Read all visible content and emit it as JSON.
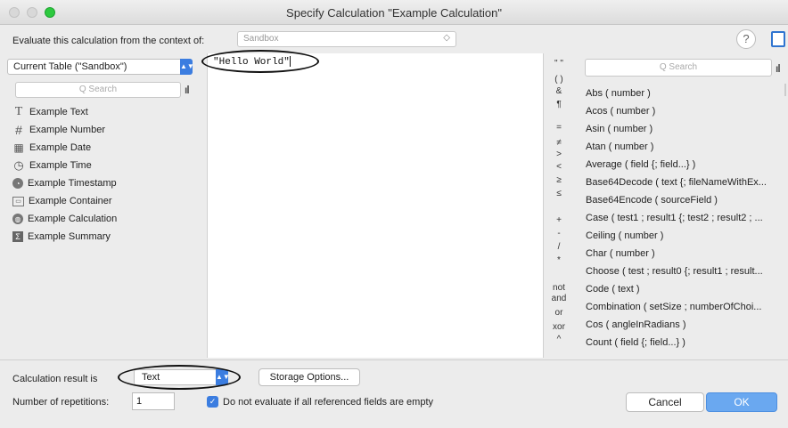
{
  "window": {
    "title": "Specify Calculation \"Example Calculation\""
  },
  "context": {
    "label": "Evaluate this calculation from the context of:",
    "value": "Sandbox",
    "arrows": "◇"
  },
  "help_glyph": "?",
  "left_pane": {
    "table_select": "Current Table (\"Sandbox\")",
    "search_placeholder": "Q Search",
    "fields": [
      {
        "label": "Example Text",
        "icon": "text-icon",
        "glyph": "T"
      },
      {
        "label": "Example Number",
        "icon": "number-icon",
        "glyph": "#"
      },
      {
        "label": "Example Date",
        "icon": "calendar-icon",
        "glyph": "▦"
      },
      {
        "label": "Example Time",
        "icon": "clock-icon",
        "glyph": "◷"
      },
      {
        "label": "Example Timestamp",
        "icon": "timestamp-icon",
        "glyph": "◔"
      },
      {
        "label": "Example Container",
        "icon": "container-icon",
        "glyph": "▭"
      },
      {
        "label": "Example Calculation",
        "icon": "calculation-icon",
        "glyph": "◍"
      },
      {
        "label": "Example Summary",
        "icon": "summary-icon",
        "glyph": "Σ"
      }
    ]
  },
  "editor": {
    "text": "\"Hello World\""
  },
  "operators": [
    "\" \"",
    "( )",
    "&",
    "¶",
    "=",
    "≠",
    ">",
    "<",
    "≥",
    "≤",
    "+",
    "-",
    "/",
    "*",
    "not",
    "and",
    "or",
    "xor",
    "^"
  ],
  "right_pane": {
    "search_placeholder": "Q Search",
    "functions": [
      "Abs ( number )",
      "Acos ( number )",
      "Asin ( number )",
      "Atan ( number )",
      "Average ( field {; field...} )",
      "Base64Decode ( text {; fileNameWithEx...",
      "Base64Encode ( sourceField )",
      "Case ( test1 ; result1 {; test2 ; result2 ; ...",
      "Ceiling ( number )",
      "Char ( number )",
      "Choose ( test ; result0 {; result1 ; result...",
      "Code ( text )",
      "Combination ( setSize ; numberOfChoi...",
      "Cos ( angleInRadians )",
      "Count ( field {; field...} )"
    ]
  },
  "bottom": {
    "result_label": "Calculation result is",
    "result_value": "Text",
    "storage_button": "Storage Options...",
    "repetitions_label": "Number of repetitions:",
    "repetitions_value": "1",
    "checkbox_label": "Do not evaluate if all referenced fields are empty",
    "cancel_button": "Cancel",
    "ok_button": "OK"
  }
}
